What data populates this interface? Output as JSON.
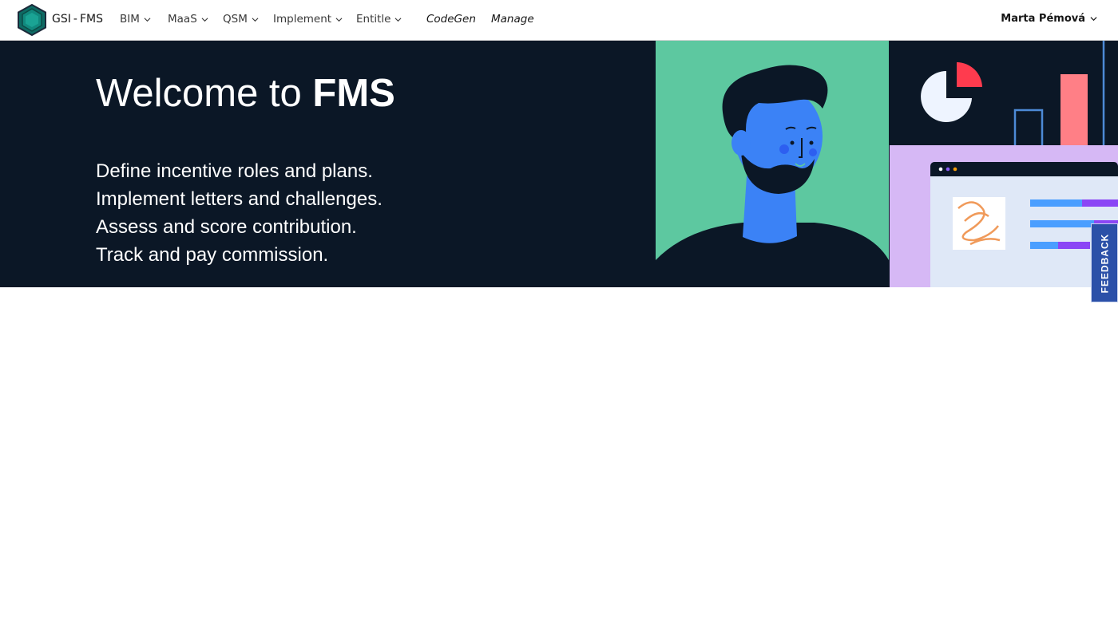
{
  "brand": {
    "app": "GSI",
    "separator": "-",
    "module": "FMS",
    "logo_icon": "hexagon-logo-icon"
  },
  "nav": {
    "items": [
      {
        "label": "BIM",
        "has_dropdown": true
      },
      {
        "label": "MaaS",
        "has_dropdown": true
      },
      {
        "label": "QSM",
        "has_dropdown": true
      },
      {
        "label": "Implement",
        "has_dropdown": true
      },
      {
        "label": "Entitle",
        "has_dropdown": true
      },
      {
        "label": "CodeGen",
        "has_dropdown": false
      },
      {
        "label": "Manage",
        "has_dropdown": false
      }
    ],
    "user_name": "Marta Pémová"
  },
  "hero": {
    "title_prefix": "Welcome to ",
    "title_bold": "FMS",
    "lines": [
      "Define incentive roles and plans.",
      "Implement letters and challenges.",
      "Assess and score contribution.",
      "Track and pay commission."
    ]
  },
  "feedback": {
    "label": "FEEDBACK"
  },
  "colors": {
    "hero_bg": "#0b1726",
    "feedback_bg": "#2b50a8",
    "illustration_green": "#5dc8a0",
    "illustration_blue": "#3b82f6",
    "illustration_lavender": "#d6b8f5"
  }
}
